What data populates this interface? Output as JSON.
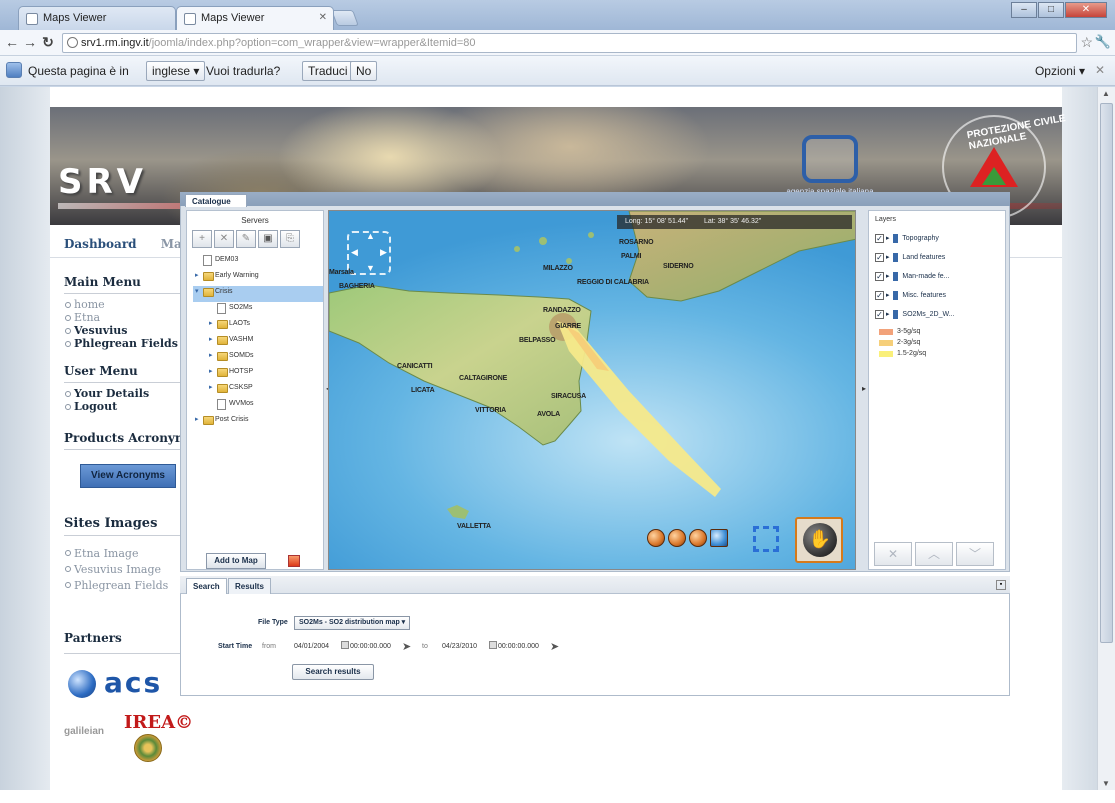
{
  "browser": {
    "tabs": [
      {
        "label": "Maps Viewer"
      },
      {
        "label": "Maps Viewer"
      }
    ],
    "url_host": "srv1.rm.ingv.it",
    "url_rest": "/joomla/index.php?option=com_wrapper&view=wrapper&Itemid=80"
  },
  "translate_bar": {
    "prefix": "Questa pagina è in",
    "language": "inglese ▾",
    "question": "Vuoi tradurla?",
    "translate": "Traduci",
    "no": "No",
    "options": "Opzioni ▾"
  },
  "banner": {
    "logo_text": "SRV",
    "asi_label": "agenzia spaziale italiana",
    "pc_text": "PROTEZIONE CIVILE NAZIONALE"
  },
  "site_nav": [
    "Dashboard",
    "Maps Viewer"
  ],
  "main_menu": {
    "title": "Main Menu",
    "items": [
      {
        "label": "home",
        "active": false
      },
      {
        "label": "Etna",
        "active": false
      },
      {
        "label": "Vesuvius",
        "active": true
      },
      {
        "label": "Phlegrean Fields",
        "active": true
      }
    ]
  },
  "user_menu": {
    "title": "User Menu",
    "items": [
      "Your Details",
      "Logout"
    ]
  },
  "products": {
    "title": "Products Acronyms",
    "button": "View Acronyms"
  },
  "sites_images": {
    "title": "Sites Images",
    "items": [
      "Etna Image",
      "Vesuvius Image",
      "Phlegrean Fields"
    ]
  },
  "partners": {
    "title": "Partners",
    "acs": "acs",
    "irea": "IREA©",
    "galileian": "galileian"
  },
  "catalogue": {
    "tab": "Catalogue",
    "servers_title": "Servers",
    "tree": [
      {
        "label": "DEM03",
        "type": "doc",
        "level": 0,
        "expandable": false
      },
      {
        "label": "Early Warning",
        "type": "folder",
        "level": 0,
        "expandable": true
      },
      {
        "label": "Crisis",
        "type": "folder",
        "level": 0,
        "expandable": true,
        "selected": true
      },
      {
        "label": "SO2Ms",
        "type": "doc",
        "level": 1,
        "expandable": false
      },
      {
        "label": "LAOTs",
        "type": "folder",
        "level": 1,
        "expandable": true
      },
      {
        "label": "VASHM",
        "type": "folder",
        "level": 1,
        "expandable": true
      },
      {
        "label": "SOMDs",
        "type": "folder",
        "level": 1,
        "expandable": true
      },
      {
        "label": "HOTSP",
        "type": "folder",
        "level": 1,
        "expandable": true
      },
      {
        "label": "CSKSP",
        "type": "folder",
        "level": 1,
        "expandable": true
      },
      {
        "label": "WVMos",
        "type": "doc",
        "level": 1,
        "expandable": false
      },
      {
        "label": "Post Crisis",
        "type": "folder",
        "level": 0,
        "expandable": true
      }
    ],
    "add_to_map": "Add to Map"
  },
  "map": {
    "long": "Long: 15° 08' 51.44\"",
    "lat": "Lat: 38° 35' 46.32\"",
    "places": [
      {
        "label": "ROSARNO"
      },
      {
        "label": "PALMI"
      },
      {
        "label": "SIDERNO"
      },
      {
        "label": "Marsala"
      },
      {
        "label": "MILAZZO"
      },
      {
        "label": "REGGIO DI CALABRIA"
      },
      {
        "label": "BAGHERIA"
      },
      {
        "label": "RANDAZZO"
      },
      {
        "label": "GIARRE"
      },
      {
        "label": "BELPASSO"
      },
      {
        "label": "CANICATTI"
      },
      {
        "label": "CALTAGIRONE"
      },
      {
        "label": "LICATA"
      },
      {
        "label": "VITTORIA"
      },
      {
        "label": "SIRACUSA"
      },
      {
        "label": "AVOLA"
      },
      {
        "label": "VALLETTA"
      }
    ]
  },
  "layers": {
    "title": "Layers",
    "items": [
      "Topography",
      "Land features",
      "Man-made fe...",
      "Misc. features",
      "SO2Ms_2D_W..."
    ],
    "legend": [
      {
        "label": "3-5g/sq",
        "color": "#f2a27a"
      },
      {
        "label": "2-3g/sq",
        "color": "#f6cf7a"
      },
      {
        "label": "1.5-2g/sq",
        "color": "#faf07a"
      }
    ]
  },
  "search": {
    "tabs": [
      "Search",
      "Results"
    ],
    "file_type_label": "File Type",
    "file_type_value": "SO2Ms - SO2 distribution map ▾",
    "start_time_label": "Start Time",
    "from_label": "from",
    "from_date": "04/01/2004",
    "from_time": "00:00:00.000",
    "to_label": "to",
    "to_date": "04/23/2010",
    "to_time": "00:00:00.000",
    "button": "Search results"
  }
}
